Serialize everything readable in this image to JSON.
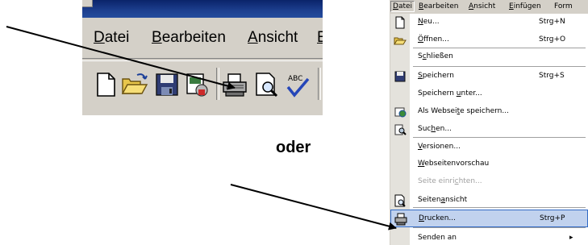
{
  "left_crop": {
    "menu": [
      {
        "pre": "",
        "u": "D",
        "post": "atei"
      },
      {
        "pre": "",
        "u": "B",
        "post": "earbeiten"
      },
      {
        "pre": "",
        "u": "A",
        "post": "nsicht"
      },
      {
        "pre": "",
        "u": "E",
        "post": ""
      }
    ],
    "toolbar_icons": [
      "new-document-icon",
      "open-folder-icon",
      "save-floppy-icon",
      "permission-icon",
      "print-icon",
      "print-preview-icon",
      "spelling-check-icon"
    ],
    "spell_icon_text": "ABC"
  },
  "connector_text": "oder",
  "right_crop": {
    "menubar": [
      {
        "pre": "",
        "u": "D",
        "post": "atei"
      },
      {
        "pre": "",
        "u": "B",
        "post": "earbeiten"
      },
      {
        "pre": "",
        "u": "A",
        "post": "nsicht"
      },
      {
        "pre": "",
        "u": "E",
        "post": "infügen"
      },
      {
        "pre": "Form",
        "u": "",
        "post": ""
      }
    ],
    "items": [
      {
        "pre": "",
        "u": "N",
        "post": "eu...",
        "shortcut": "Strg+N",
        "icon": "new-document-icon",
        "state": "normal"
      },
      {
        "pre": "",
        "u": "Ö",
        "post": "ffnen...",
        "shortcut": "Strg+O",
        "icon": "open-folder-icon",
        "state": "normal"
      },
      {
        "pre": "S",
        "u": "c",
        "post": "hließen",
        "shortcut": "",
        "icon": "",
        "state": "normal"
      },
      {
        "pre": "",
        "u": "S",
        "post": "peichern",
        "shortcut": "Strg+S",
        "icon": "save-floppy-icon",
        "state": "normal"
      },
      {
        "pre": "Speichern ",
        "u": "u",
        "post": "nter...",
        "shortcut": "",
        "icon": "",
        "state": "normal"
      },
      {
        "pre": "Als Websei",
        "u": "t",
        "post": "e speichern...",
        "shortcut": "",
        "icon": "web-page-icon",
        "state": "normal"
      },
      {
        "pre": "Suc",
        "u": "h",
        "post": "en...",
        "shortcut": "",
        "icon": "search-document-icon",
        "state": "normal"
      },
      {
        "pre": "",
        "u": "V",
        "post": "ersionen...",
        "shortcut": "",
        "icon": "",
        "state": "normal"
      },
      {
        "pre": "",
        "u": "W",
        "post": "ebseitenvorschau",
        "shortcut": "",
        "icon": "",
        "state": "normal"
      },
      {
        "pre": "Seite einri",
        "u": "c",
        "post": "hten...",
        "shortcut": "",
        "icon": "",
        "state": "disabled"
      },
      {
        "pre": "Seiten",
        "u": "a",
        "post": "nsicht",
        "shortcut": "",
        "icon": "print-preview-icon",
        "state": "normal"
      },
      {
        "pre": "",
        "u": "D",
        "post": "rucken...",
        "shortcut": "Strg+P",
        "icon": "print-icon",
        "state": "highlighted"
      },
      {
        "pre": "Senden an",
        "u": "",
        "post": "",
        "shortcut": "▸",
        "icon": "",
        "state": "normal"
      }
    ]
  },
  "colors": {
    "title_bar": "#0a246a",
    "menu_face": "#d4d0c8",
    "highlight_fill": "#c1d2ee",
    "highlight_border": "#316ac5",
    "arrow": "#000000"
  }
}
